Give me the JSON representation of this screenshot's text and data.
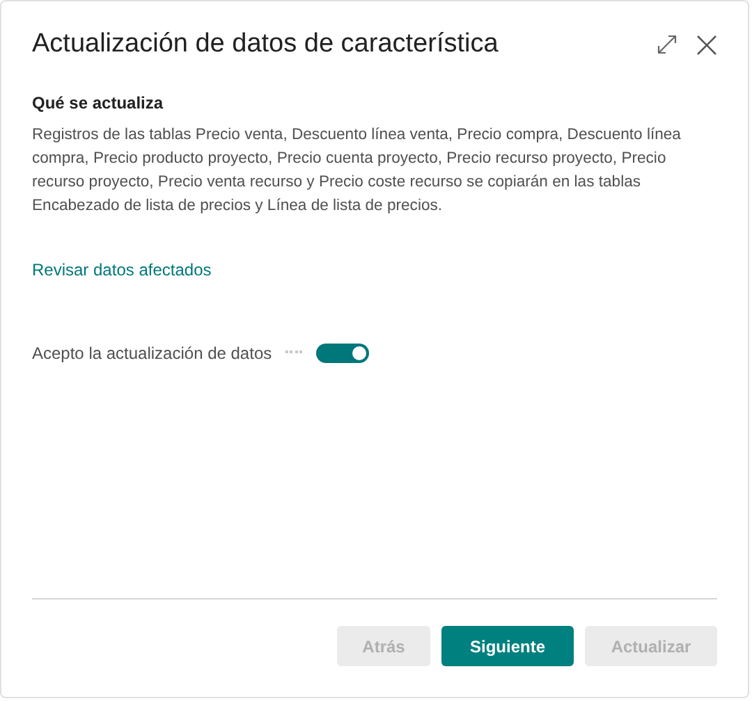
{
  "dialog": {
    "title": "Actualización de datos de característica"
  },
  "section": {
    "heading": "Qué se actualiza",
    "body": "Registros de las tablas Precio venta, Descuento línea venta, Precio compra, Descuento línea compra, Precio producto proyecto, Precio cuenta proyecto, Precio recurso proyecto, Precio recurso proyecto, Precio venta recurso y Precio coste recurso se copiarán en las tablas Encabezado de lista de precios y Línea de lista de precios."
  },
  "link": "Revisar datos afectados",
  "toggle": {
    "label": "Acepto la actualización de datos",
    "on": true
  },
  "buttons": [
    {
      "label": "Atrás",
      "kind": "secondary",
      "disabled": true
    },
    {
      "label": "Siguiente",
      "kind": "primary",
      "disabled": false
    },
    {
      "label": "Actualizar",
      "kind": "secondary",
      "disabled": true
    }
  ]
}
